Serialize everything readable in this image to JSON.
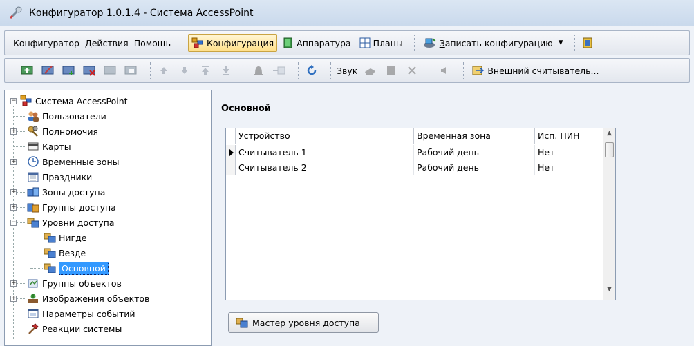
{
  "window": {
    "title": "Конфигуратор 1.0.1.4 - Система AccessPoint"
  },
  "menubar": {
    "menus": [
      "Конфигуратор",
      "Действия",
      "Помощь"
    ],
    "views": [
      {
        "label": "Конфигурация",
        "active": true,
        "icon": "configuration-icon"
      },
      {
        "label": "Аппаратура",
        "active": false,
        "icon": "hardware-icon"
      },
      {
        "label": "Планы",
        "active": false,
        "icon": "plans-icon"
      }
    ],
    "write_config_label": "Записать конфигурацию"
  },
  "toolbar": {
    "sound_label": "Звук",
    "external_reader_label": "Внешний считыватель..."
  },
  "tree": {
    "root": "Система AccessPoint",
    "items": [
      {
        "label": "Пользователи",
        "icon": "users-icon"
      },
      {
        "label": "Полномочия",
        "icon": "keys-icon"
      },
      {
        "label": "Карты",
        "icon": "card-icon"
      },
      {
        "label": "Временные зоны",
        "icon": "clock-icon"
      },
      {
        "label": "Праздники",
        "icon": "calendar-icon"
      },
      {
        "label": "Зоны доступа",
        "icon": "access-zone-icon"
      },
      {
        "label": "Группы доступа",
        "icon": "access-group-icon"
      },
      {
        "label": "Уровни доступа",
        "icon": "access-level-icon"
      },
      {
        "label": "Нигде",
        "icon": "access-level-icon"
      },
      {
        "label": "Везде",
        "icon": "access-level-icon"
      },
      {
        "label": "Основной",
        "icon": "access-level-icon",
        "selected": true
      },
      {
        "label": "Группы объектов",
        "icon": "object-group-icon"
      },
      {
        "label": "Изображения объектов",
        "icon": "object-image-icon"
      },
      {
        "label": "Параметры событий",
        "icon": "event-params-icon"
      },
      {
        "label": "Реакции системы",
        "icon": "hammer-icon"
      }
    ]
  },
  "main": {
    "section_title": "Основной",
    "columns": [
      "Устройство",
      "Временная зона",
      "Исп. ПИН"
    ],
    "rows": [
      [
        "Считыватель 1",
        "Рабочий день",
        "Нет"
      ],
      [
        "Считыватель 2",
        "Рабочий день",
        "Нет"
      ]
    ],
    "wizard_button_label": "Мастер уровня доступа"
  },
  "colors": {
    "selection": "#3399ff",
    "active_view": "#ffe08a"
  }
}
